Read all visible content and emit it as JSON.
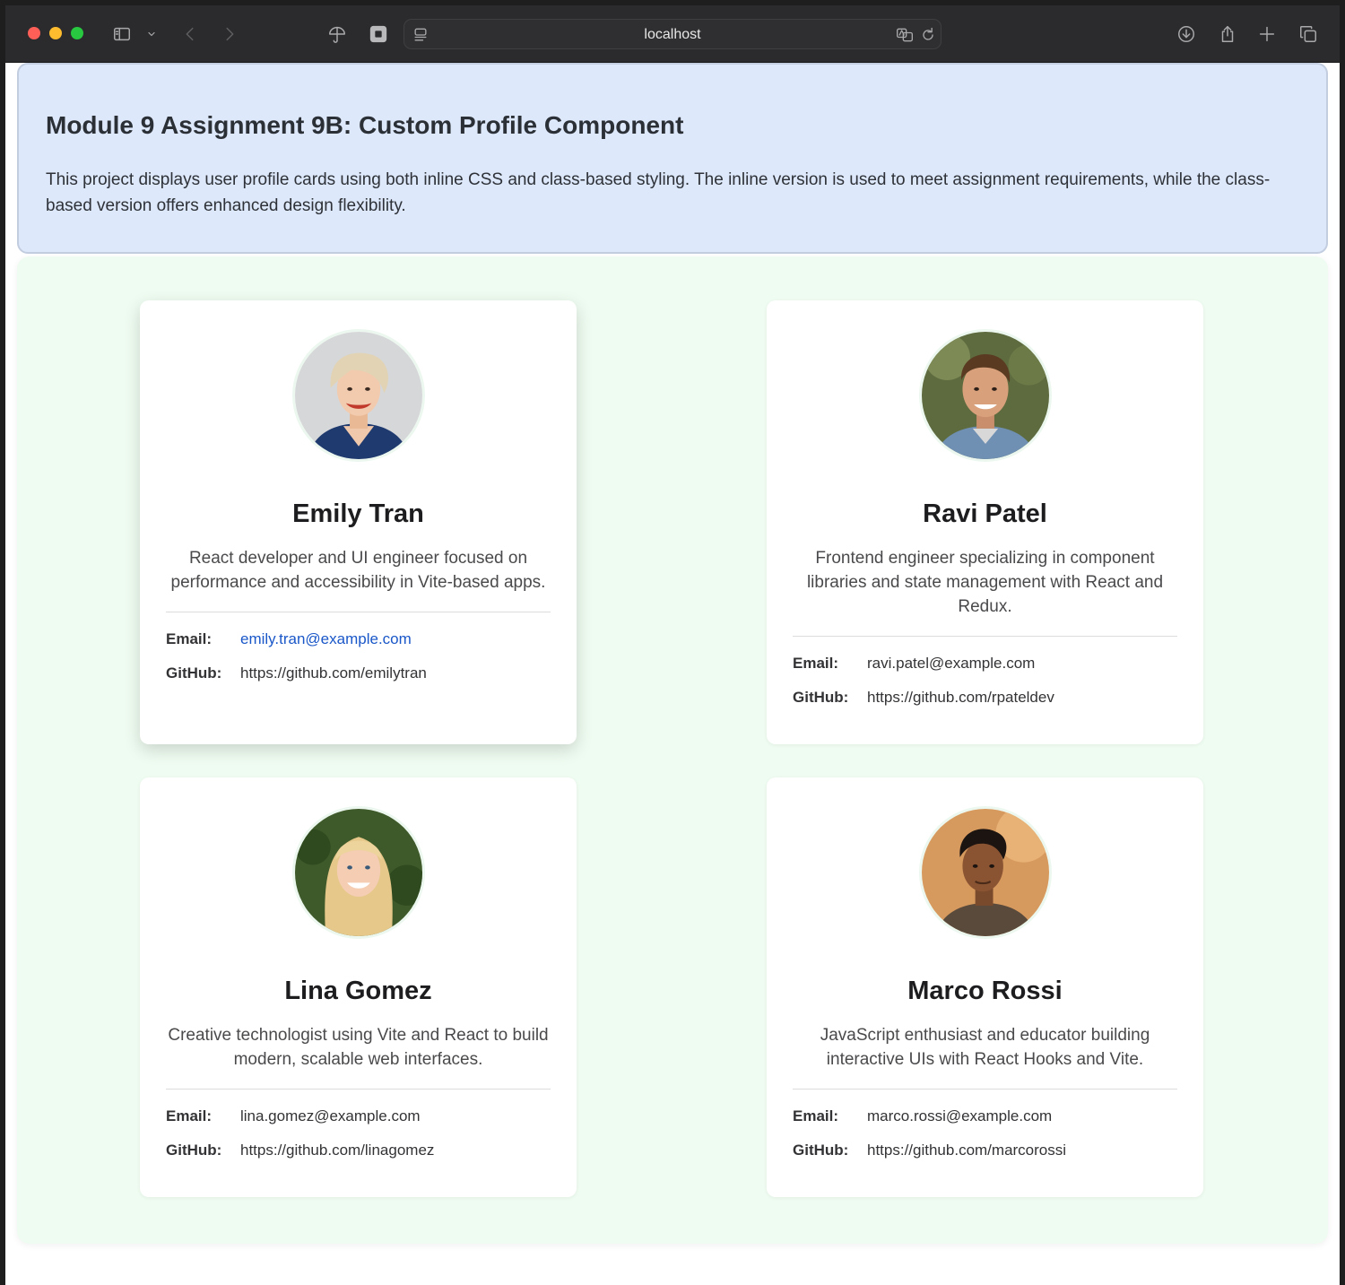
{
  "browser": {
    "url": "localhost"
  },
  "header": {
    "title": "Module 9 Assignment 9B: Custom Profile Component",
    "description": "This project displays user profile cards using both inline CSS and class-based styling. The inline version is used to meet assignment requirements, while the class-based version offers enhanced design flexibility."
  },
  "labels": {
    "email": "Email:",
    "github": "GitHub:"
  },
  "profiles": [
    {
      "name": "Emily Tran",
      "bio": "React developer and UI engineer focused on performance and accessibility in Vite-based apps.",
      "email": "emily.tran@example.com",
      "github": "https://github.com/emilytran"
    },
    {
      "name": "Ravi Patel",
      "bio": "Frontend engineer specializing in component libraries and state management with React and Redux.",
      "email": "ravi.patel@example.com",
      "github": "https://github.com/rpateldev"
    },
    {
      "name": "Lina Gomez",
      "bio": "Creative technologist using Vite and React to build modern, scalable web interfaces.",
      "email": "lina.gomez@example.com",
      "github": "https://github.com/linagomez"
    },
    {
      "name": "Marco Rossi",
      "bio": "JavaScript enthusiast and educator building interactive UIs with React Hooks and Vite.",
      "email": "marco.rossi@example.com",
      "github": "https://github.com/marcorossi"
    }
  ]
}
